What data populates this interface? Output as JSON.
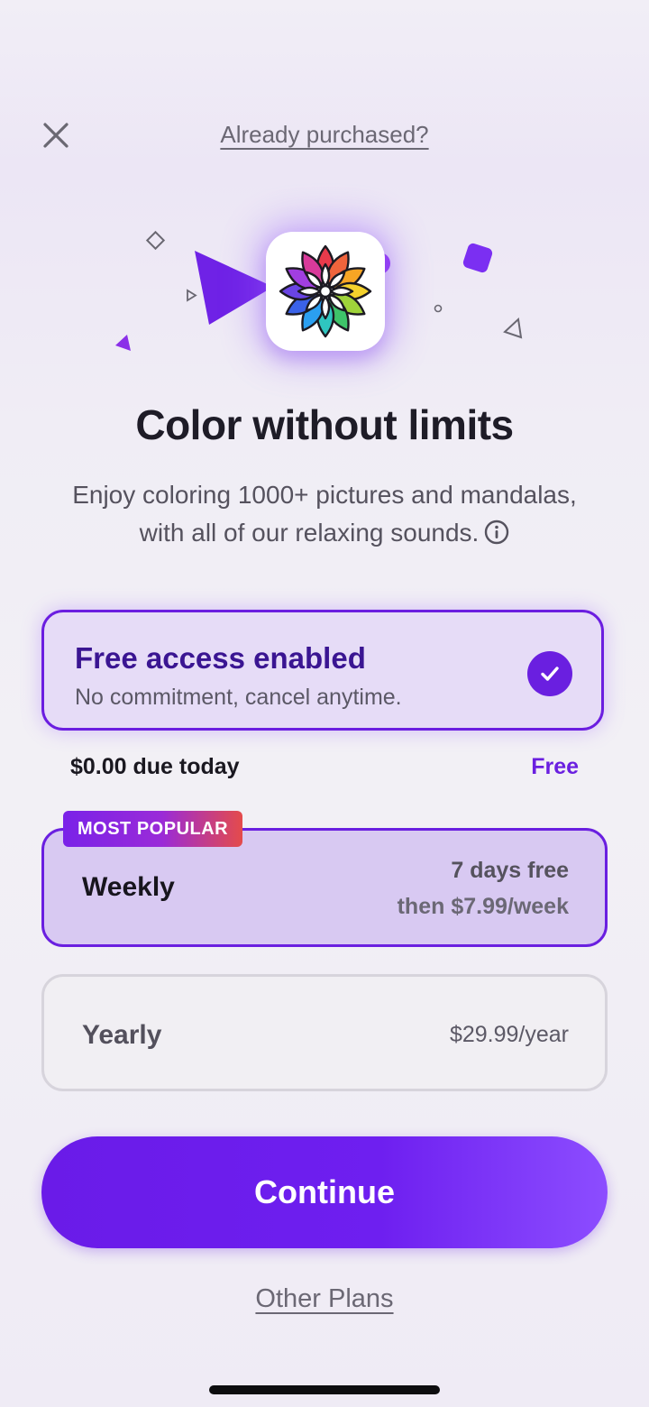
{
  "header": {
    "close_icon": "close-icon",
    "already_purchased_label": "Already purchased?"
  },
  "hero": {
    "app_icon": "mandala-app-icon",
    "accent_color": "#7b2ff2"
  },
  "headline": "Color without limits",
  "subtitle": {
    "line1": "Enjoy coloring 1000+ pictures and mandalas,",
    "line2": "with all of our relaxing sounds.",
    "info_icon": "info-icon"
  },
  "free_access": {
    "title": "Free access enabled",
    "subtitle": "No commitment, cancel anytime.",
    "checked": true
  },
  "due": {
    "label": "$0.00 due today",
    "value": "Free"
  },
  "plans": [
    {
      "badge": "MOST POPULAR",
      "label": "Weekly",
      "price_line1": "7 days free",
      "price_line2": "then $7.99/week",
      "selected": true
    },
    {
      "label": "Yearly",
      "price": "$29.99/year",
      "selected": false
    }
  ],
  "continue_label": "Continue",
  "other_plans_label": "Other Plans",
  "colors": {
    "primary": "#6a1fe0",
    "selected_card_bg": "#d8c9f2",
    "badge_gradient_end": "#e44b4b"
  }
}
